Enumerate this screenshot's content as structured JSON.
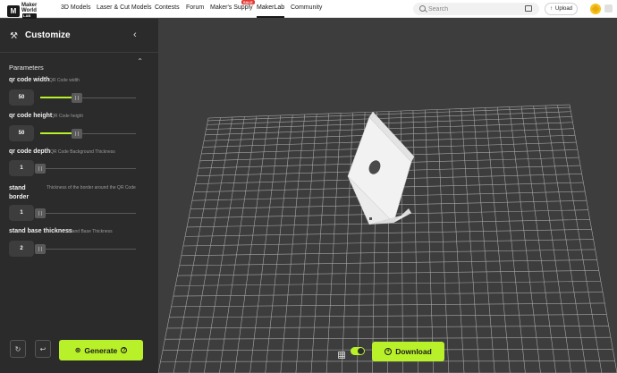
{
  "nav": {
    "logo_mark": "M",
    "logo_line1": "Maker",
    "logo_line2": "World",
    "logo_tag": "LAB",
    "items": [
      {
        "label": "3D Models"
      },
      {
        "label": "Laser & Cut Models"
      },
      {
        "label": "Contests"
      },
      {
        "label": "Forum"
      },
      {
        "label": "Maker's Supply"
      },
      {
        "label": "MakerLab"
      },
      {
        "label": "Community"
      }
    ],
    "sale_badge": "SALE",
    "active": "MakerLab",
    "search_placeholder": "Search",
    "upload_label": "Upload",
    "upload_icon": "↑"
  },
  "sidebar": {
    "title": "Customize",
    "wand_icon": "⚒",
    "collapse_icon": "‹",
    "section_title": "Parameters",
    "section_chevron": "⌃",
    "params": [
      {
        "label": "qr code width",
        "desc": "QR Code width",
        "value": "50",
        "fill": 0.38
      },
      {
        "label": "qr code height",
        "desc": "QR Code height",
        "value": "50",
        "fill": 0.38
      },
      {
        "label": "qr code depth",
        "desc": "QR Code Background Thickness",
        "value": "1",
        "fill": 0.0
      },
      {
        "label": "stand border",
        "desc": "Thickness of the border around the QR Code",
        "value": "1",
        "fill": 0.0
      },
      {
        "label": "stand base thickness",
        "desc": "Stand Base Thickness",
        "value": "2",
        "fill": 0.0
      }
    ],
    "reset_icon": "↻",
    "undo_icon": "↩",
    "generate_label": "Generate",
    "generate_icon": "⊛",
    "help_icon": "?"
  },
  "viewport": {
    "download_label": "Download",
    "download_icon": "+",
    "grid_toggle_on": true,
    "accent_color": "#b8f02a"
  }
}
